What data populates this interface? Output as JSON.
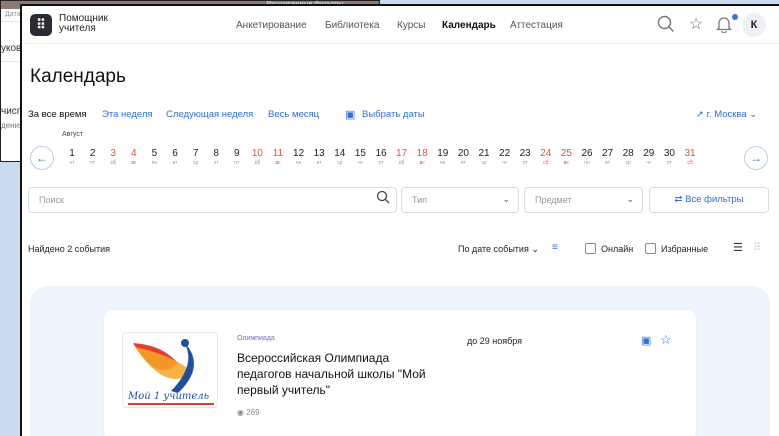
{
  "background_window": {
    "topbar_text": "Расширенные фильтры ⌄",
    "lines": [
      "Дата начала мероприятия",
      "укове",
      "чисп",
      "дения"
    ]
  },
  "header": {
    "logo_glyph": "⠿",
    "logo_line1": "Помощник",
    "logo_line2": "учителя",
    "nav": [
      "Анкетирование",
      "Библиотека",
      "Курсы",
      "Календарь",
      "Аттестация"
    ],
    "avatar": "К"
  },
  "page_title": "Календарь",
  "period_filters": {
    "all_time": "За все время",
    "this_week": "Эта неделя",
    "next_week": "Следующая неделя",
    "whole_month": "Весь месяц",
    "pick_dates": "Выбрать даты",
    "city": "г. Москва"
  },
  "calendar_strip": {
    "month": "Август",
    "days": [
      {
        "n": "1",
        "w": "чт"
      },
      {
        "n": "2",
        "w": "пт"
      },
      {
        "n": "3",
        "w": "сб"
      },
      {
        "n": "4",
        "w": "вс"
      },
      {
        "n": "5",
        "w": "пн"
      },
      {
        "n": "6",
        "w": "вт"
      },
      {
        "n": "7",
        "w": "ср"
      },
      {
        "n": "8",
        "w": "чт"
      },
      {
        "n": "9",
        "w": "пт"
      },
      {
        "n": "10",
        "w": "сб"
      },
      {
        "n": "11",
        "w": "вс"
      },
      {
        "n": "12",
        "w": "пн"
      },
      {
        "n": "13",
        "w": "вт"
      },
      {
        "n": "14",
        "w": "ср"
      },
      {
        "n": "15",
        "w": "чт"
      },
      {
        "n": "16",
        "w": "пт"
      },
      {
        "n": "17",
        "w": "сб"
      },
      {
        "n": "18",
        "w": "вс"
      },
      {
        "n": "19",
        "w": "пн"
      },
      {
        "n": "20",
        "w": "вт"
      },
      {
        "n": "21",
        "w": "ср"
      },
      {
        "n": "22",
        "w": "чт"
      },
      {
        "n": "23",
        "w": "пт"
      },
      {
        "n": "24",
        "w": "сб"
      },
      {
        "n": "25",
        "w": "вс"
      },
      {
        "n": "26",
        "w": "пн"
      },
      {
        "n": "27",
        "w": "вт"
      },
      {
        "n": "28",
        "w": "ср"
      },
      {
        "n": "29",
        "w": "чт"
      },
      {
        "n": "30",
        "w": "пт"
      },
      {
        "n": "31",
        "w": "сб"
      }
    ]
  },
  "search": {
    "placeholder": "Поиск",
    "type_placeholder": "Тип",
    "subject_placeholder": "Предмет",
    "all_filters": "Все фильтры"
  },
  "results": {
    "found": "Найдено 2 события",
    "sort": "По дате события ⌄",
    "online": "Онлайн",
    "favorites": "Избранные"
  },
  "event": {
    "type": "Олимпиада",
    "title": "Всероссийская Олимпиада педагогов начальной школы \"Мой первый учитель\"",
    "date": "до 29 ноября",
    "views": "269",
    "logo_text": "Мой 1 учитель"
  },
  "colors": {
    "accent": "#2f6ee0",
    "weekend": "#e0513c",
    "panel": "#eef4fb"
  }
}
